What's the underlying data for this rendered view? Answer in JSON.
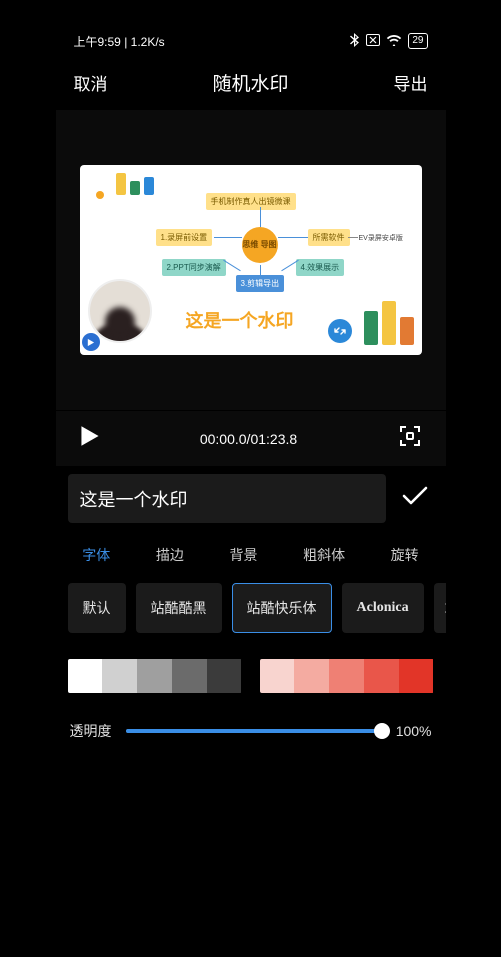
{
  "status_bar": {
    "time": "上午9:59",
    "speed": "1.2K/s",
    "battery_pct": "29"
  },
  "header": {
    "cancel": "取消",
    "title": "随机水印",
    "export": "导出"
  },
  "preview": {
    "mindmap_center": "思维\n导图",
    "box_top": "手机制作真人出镜微课",
    "box_1": "1.录屏前设置",
    "box_2": "2.PPT同步演解",
    "box_3": "3.剪辑导出",
    "box_4": "4.效果展示",
    "box_soft": "所需软件",
    "label_right": "EV录屏安卓版",
    "watermark_text": "这是一个水印"
  },
  "transport": {
    "time": "00:00.0/01:23.8"
  },
  "input": {
    "value": "这是一个水印"
  },
  "tabs": {
    "font": "字体",
    "stroke": "描边",
    "background": "背景",
    "bolditalic": "粗斜体",
    "rotate": "旋转"
  },
  "fonts": {
    "default": "默认",
    "zk_kuhei": "站酷酷黑",
    "zk_kuaile": "站酷快乐体",
    "aclonica": "Aclonica",
    "partial": "站"
  },
  "colors": {
    "greys": [
      "#ffffff",
      "#d0d0d0",
      "#9f9f9f",
      "#6b6b6b",
      "#3b3b3b"
    ],
    "reds": [
      "#f8d4cf",
      "#f4aba1",
      "#ef8074",
      "#e9564a",
      "#e23528"
    ]
  },
  "opacity": {
    "label": "透明度",
    "percent": 100,
    "display": "100%"
  }
}
